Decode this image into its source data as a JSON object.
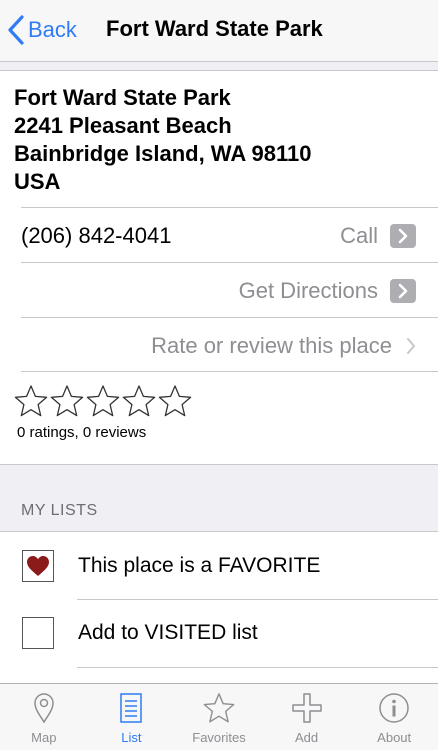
{
  "nav": {
    "back_label": "Back",
    "title": "Fort Ward State Park"
  },
  "place": {
    "address_lines": [
      "Fort Ward State Park",
      "2241 Pleasant Beach",
      "Bainbridge Island, WA 98110",
      "USA"
    ],
    "phone": "(206) 842-4041",
    "call_label": "Call",
    "directions_label": "Get Directions",
    "review_label": "Rate or review this place",
    "rating": 0,
    "max_rating": 5,
    "rating_summary": "0 ratings, 0 reviews"
  },
  "my_lists": {
    "header": "MY LISTS",
    "items": [
      {
        "label": "This place is a FAVORITE",
        "checked": true
      },
      {
        "label": "Add to VISITED list",
        "checked": false
      }
    ]
  },
  "tabbar": {
    "items": [
      {
        "label": "Map",
        "icon": "map-pin-icon",
        "active": false
      },
      {
        "label": "List",
        "icon": "list-icon",
        "active": true
      },
      {
        "label": "Favorites",
        "icon": "star-icon",
        "active": false
      },
      {
        "label": "Add",
        "icon": "plus-icon",
        "active": false
      },
      {
        "label": "About",
        "icon": "info-icon",
        "active": false
      }
    ]
  },
  "colors": {
    "accent": "#2f7cf6",
    "heart": "#8b1a1a",
    "gray_text": "#8e8e93"
  }
}
